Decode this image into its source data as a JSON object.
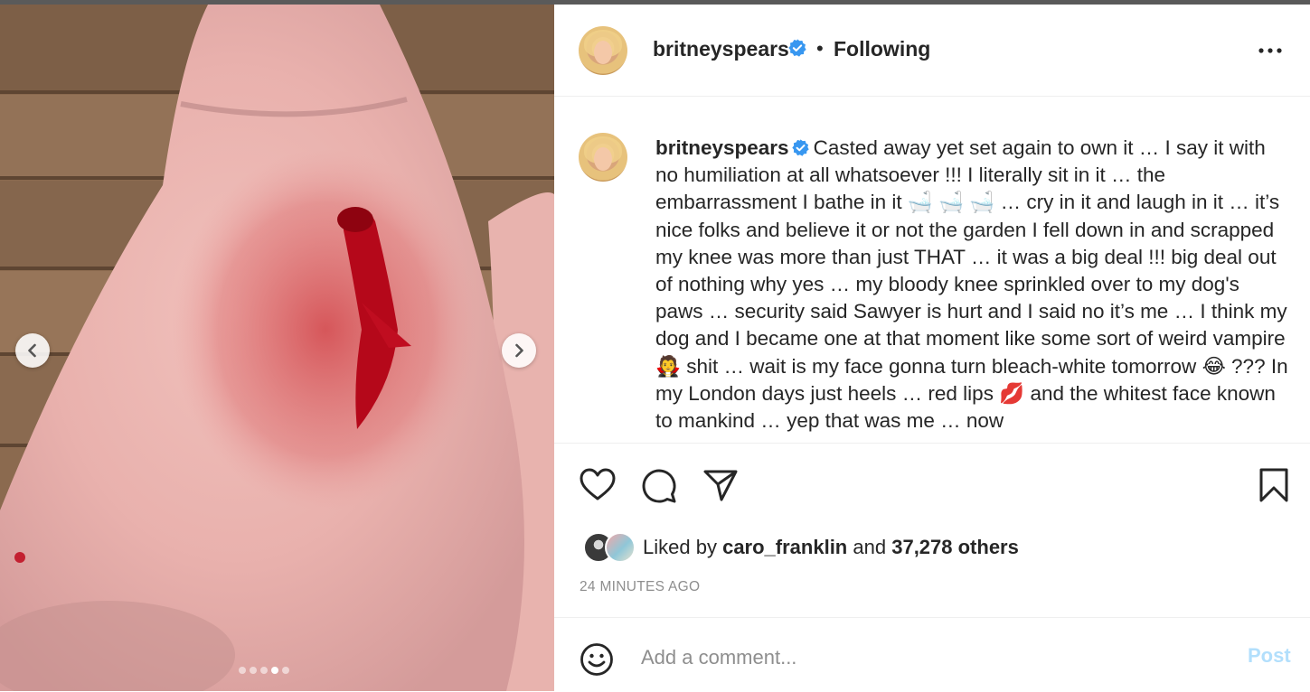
{
  "post": {
    "username": "britneyspears",
    "follow_state": "Following",
    "separator": "•",
    "more_icon": "more-horizontal-icon",
    "verified_icon": "verified-badge-icon",
    "caption": "Casted away yet set again to own it … I say it with no humiliation at all whatsoever !!! I literally sit in it … the embarrassment I bathe in it 🛁 🛁 🛁 … cry in it and laugh in it … it’s nice folks and believe it or not the garden I fell down in and scrapped my knee was more than just THAT … it was a big deal !!! big deal out of nothing why yes … my bloody knee sprinkled over to my dog's paws … security said Sawyer is hurt and I said no it’s me … I think my dog and I became one at that moment like some sort of weird vampire 🧛 shit … wait is my face gonna turn bleach-white tomorrow 😂 ??? In my London days just heels … red lips 💋 and the whitest face known to mankind … yep that was me … now",
    "likes": {
      "prefix": "Liked by",
      "user": "caro_franklin",
      "joiner": "and",
      "others": "37,278 others"
    },
    "timestamp": "24 MINUTES AGO"
  },
  "media": {
    "slide_count": 5,
    "active_slide": 4,
    "prev_icon": "chevron-left-icon",
    "next_icon": "chevron-right-icon"
  },
  "actions": {
    "like_icon": "heart-icon",
    "comment_icon": "comment-icon",
    "share_icon": "paper-plane-icon",
    "save_icon": "bookmark-icon"
  },
  "comment_box": {
    "placeholder": "Add a comment...",
    "post_label": "Post",
    "emoji_icon": "smiley-icon"
  },
  "colors": {
    "verified": "#3897f0",
    "post_disabled": "#b2dffc",
    "muted": "#8e8e8e",
    "text": "#262626"
  }
}
